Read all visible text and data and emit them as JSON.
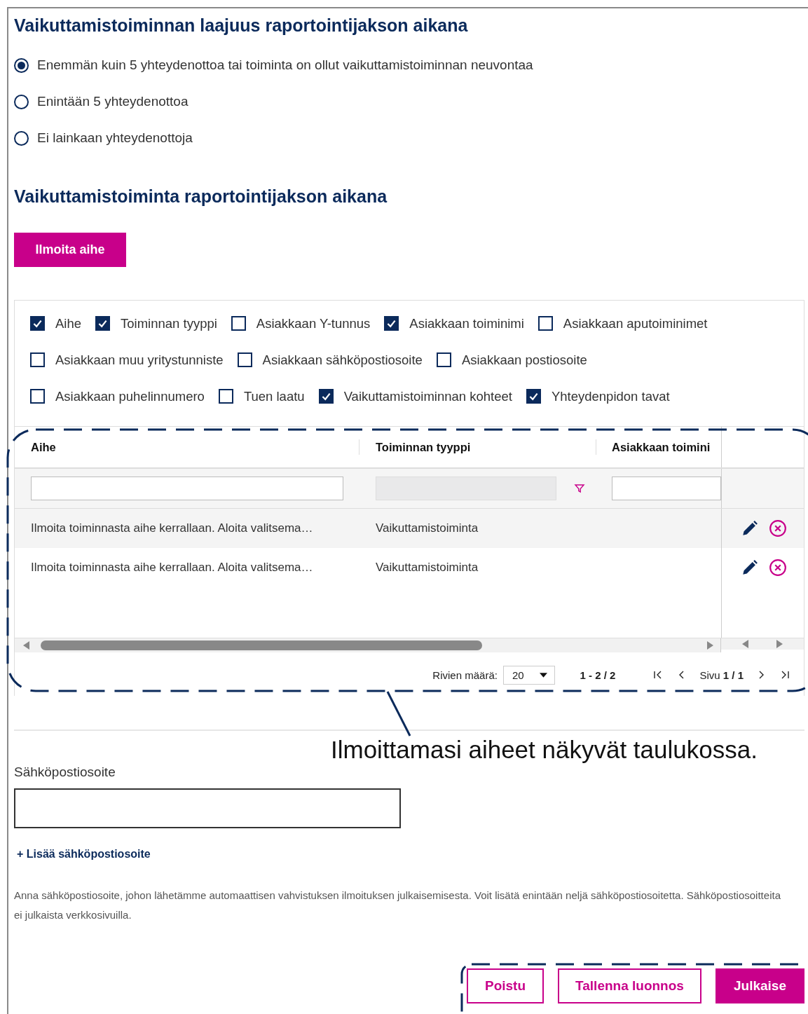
{
  "scope": {
    "title": "Vaikuttamistoiminnan laajuus raportointijakson aikana",
    "options": [
      {
        "label": "Enemmän kuin 5 yhteydenottoa tai toiminta on ollut vaikuttamistoiminnan neuvontaa",
        "selected": true
      },
      {
        "label": "Enintään 5 yhteydenottoa",
        "selected": false
      },
      {
        "label": "Ei lainkaan yhteydenottoja",
        "selected": false
      }
    ]
  },
  "activity": {
    "title": "Vaikuttamistoiminta raportointijakson aikana",
    "add_button": "Ilmoita aihe",
    "column_toggles": [
      [
        {
          "label": "Aihe",
          "checked": true
        },
        {
          "label": "Toiminnan tyyppi",
          "checked": true
        },
        {
          "label": "Asiakkaan Y-tunnus",
          "checked": false
        },
        {
          "label": "Asiakkaan toiminimi",
          "checked": true
        },
        {
          "label": "Asiakkaan aputoiminimet",
          "checked": false
        }
      ],
      [
        {
          "label": "Asiakkaan muu yritystunniste",
          "checked": false
        },
        {
          "label": "Asiakkaan sähköpostiosoite",
          "checked": false
        },
        {
          "label": "Asiakkaan postiosoite",
          "checked": false
        }
      ],
      [
        {
          "label": "Asiakkaan puhelinnumero",
          "checked": false
        },
        {
          "label": "Tuen laatu",
          "checked": false
        },
        {
          "label": "Vaikuttamistoiminnan kohteet",
          "checked": true
        },
        {
          "label": "Yhteydenpidon tavat",
          "checked": true
        }
      ]
    ],
    "table": {
      "columns": [
        {
          "label": "Aihe",
          "kind": "text"
        },
        {
          "label": "Toiminnan tyyppi",
          "kind": "dropdown"
        },
        {
          "label": "Asiakkaan toimini",
          "kind": "text"
        }
      ],
      "rows": [
        {
          "cells": [
            "Ilmoita toiminnasta aihe kerrallaan. Aloita valitsema…",
            "Vaikuttamistoiminta"
          ]
        },
        {
          "cells": [
            "Ilmoita toiminnasta aihe kerrallaan. Aloita valitsema…",
            "Vaikuttamistoiminta"
          ]
        }
      ],
      "pagination": {
        "rows_label": "Rivien määrä:",
        "page_size": "20",
        "range": "1 - 2 / 2",
        "page": "Sivu **1 / 1**"
      }
    }
  },
  "email": {
    "label": "Sähköpostiosoite",
    "add_link": "+ Lisää sähköpostiosoite",
    "help": "Anna sähköpostiosoite, johon lähetämme automaattisen vahvistuksen ilmoituksen julkaisemisesta. Voit lisätä enintään neljä sähköpostiosoitetta. Sähköpostiosoitteita ei julkaista verkkosivuilla."
  },
  "actions": [
    {
      "label": "Poistu",
      "kind": "secondary"
    },
    {
      "label": "Tallenna luonnos",
      "kind": "secondary"
    },
    {
      "label": "Julkaise",
      "kind": "primary"
    }
  ],
  "annotation": {
    "text": "Ilmoittamasi aiheet näkyvät taulukossa."
  }
}
